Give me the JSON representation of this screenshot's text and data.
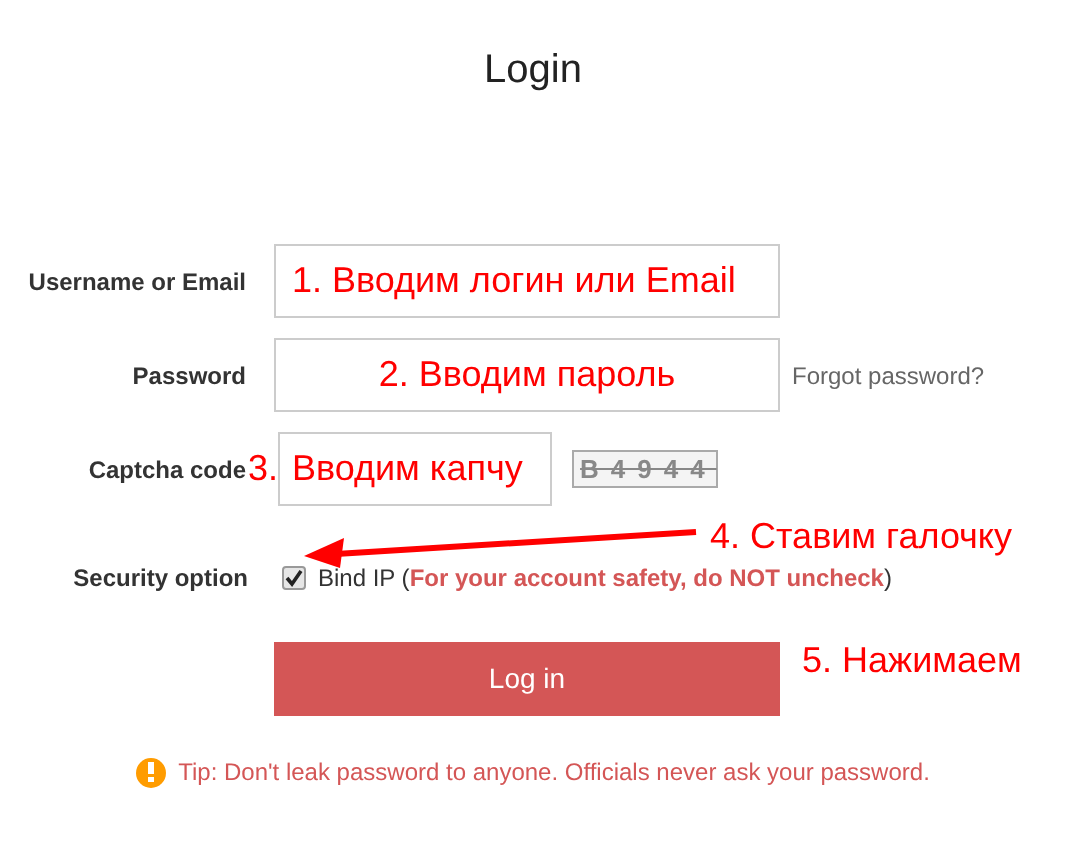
{
  "title": "Login",
  "fields": [
    {
      "label": "Username or Email",
      "kind": "text",
      "value": "1. Вводим логин или Email"
    },
    {
      "label": "Password",
      "kind": "password",
      "value": "2. Вводим пароль",
      "link": "Forgot password?"
    },
    {
      "label": "Captcha code",
      "kind": "captcha",
      "marker": "3.",
      "value": "Вводим капчу",
      "captcha": "B4944"
    }
  ],
  "security": {
    "label": "Security option",
    "checked": true,
    "option": "Bind IP (",
    "note": "For your account safety, do NOT uncheck",
    "close": ")"
  },
  "login_button": "Log in",
  "tip": "Tip: Don't leak password to anyone. Officials never ask your password.",
  "annotations": [
    "4. Ставим галочку",
    "5. Нажимаем"
  ]
}
